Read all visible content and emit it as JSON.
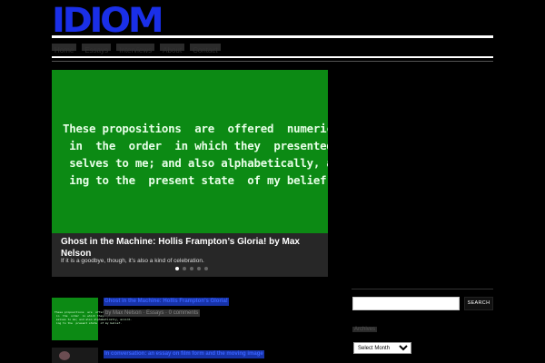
{
  "site": {
    "logo_text": "IDIOM",
    "brand_color": "#1a2fe8"
  },
  "nav": {
    "items": [
      {
        "label": "Home"
      },
      {
        "label": "Essays"
      },
      {
        "label": "Interviews"
      },
      {
        "label": "About"
      },
      {
        "label": "Contact"
      }
    ]
  },
  "slider": {
    "image_text": "These propositions  are  offered  numerically,\n in  the  order  in which they  presented them-\n selves to me; and also alphabetically, accord-\n ing to the  present state  of my belief.",
    "title": "Ghost in the Machine: Hollis Frampton’s Gloria! by Max Nelson",
    "excerpt": "If it is a goodbye, though, it’s also a kind of celebration.",
    "slide_count": 5,
    "active_slide": 1
  },
  "posts": [
    {
      "title": "Ghost in the Machine: Hollis Frampton’s Gloria!",
      "meta": "by Max Nelson · Essays · 0 comments"
    },
    {
      "title": "In conversation: an essay on film form and the moving image",
      "meta": ""
    }
  ],
  "sidebar": {
    "search_placeholder": "",
    "search_button": "SEARCH",
    "archives_title": "Archives",
    "archive_select": "Select Month"
  }
}
